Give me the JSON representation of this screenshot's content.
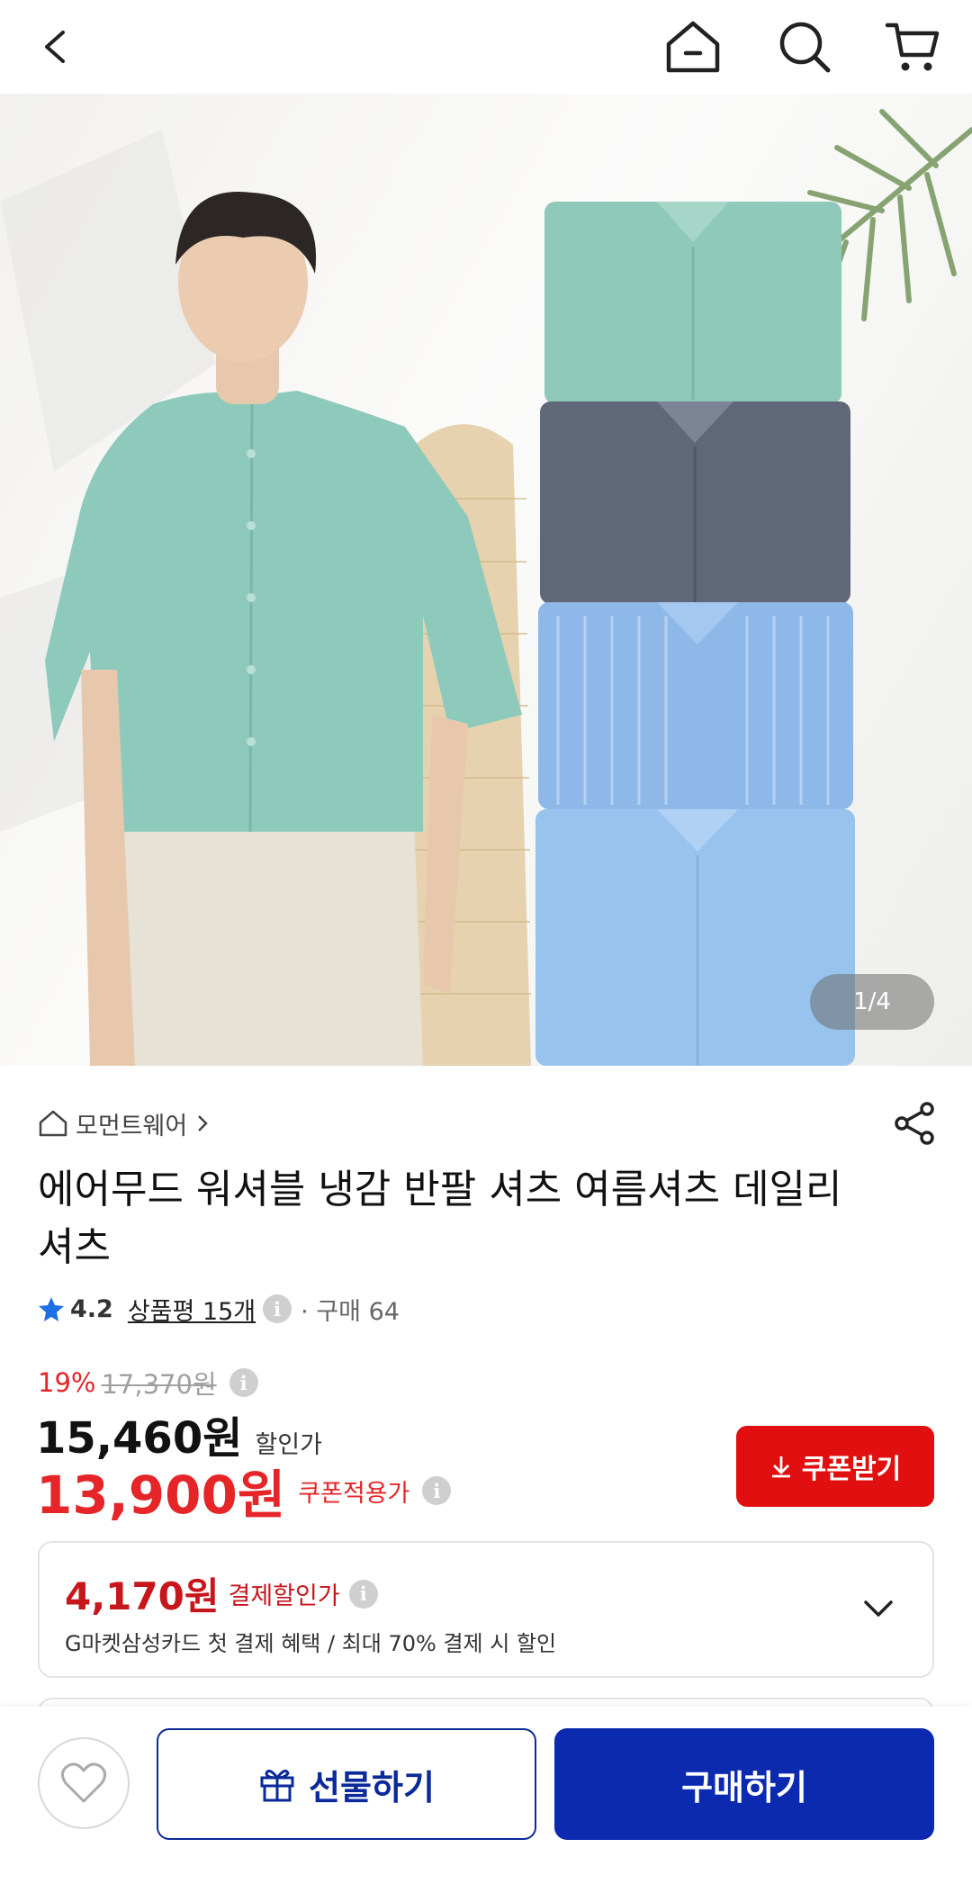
{
  "topbar": {
    "icons": [
      "back-icon",
      "home-icon",
      "search-icon",
      "cart-icon"
    ]
  },
  "hero": {
    "counter": "1/4"
  },
  "product": {
    "store": "모먼트웨어",
    "title": "에어무드 워셔블 냉감 반팔 셔츠 여름셔츠 데일리셔츠",
    "rating": "4.2",
    "reviews": "상품평 15개",
    "purchases": "구매 64"
  },
  "price": {
    "discount": "19%",
    "original": "17,370원",
    "sale": "15,460원",
    "sale_label": "할인가",
    "coupon_price": "13,900원",
    "coupon_label": "쿠폰적용가",
    "coupon_button": "쿠폰받기"
  },
  "payment": {
    "amount": "4,170원",
    "label": "결제할인가",
    "desc": "G마켓삼성카드 첫 결제 혜택 / 최대 70% 결제 시 할인"
  },
  "bottom": {
    "gift": "선물하기",
    "buy": "구매하기"
  },
  "colors": {
    "accent_red": "#e52528",
    "brand_blue": "#0b2ab0",
    "coupon_red": "#e10f0f"
  }
}
